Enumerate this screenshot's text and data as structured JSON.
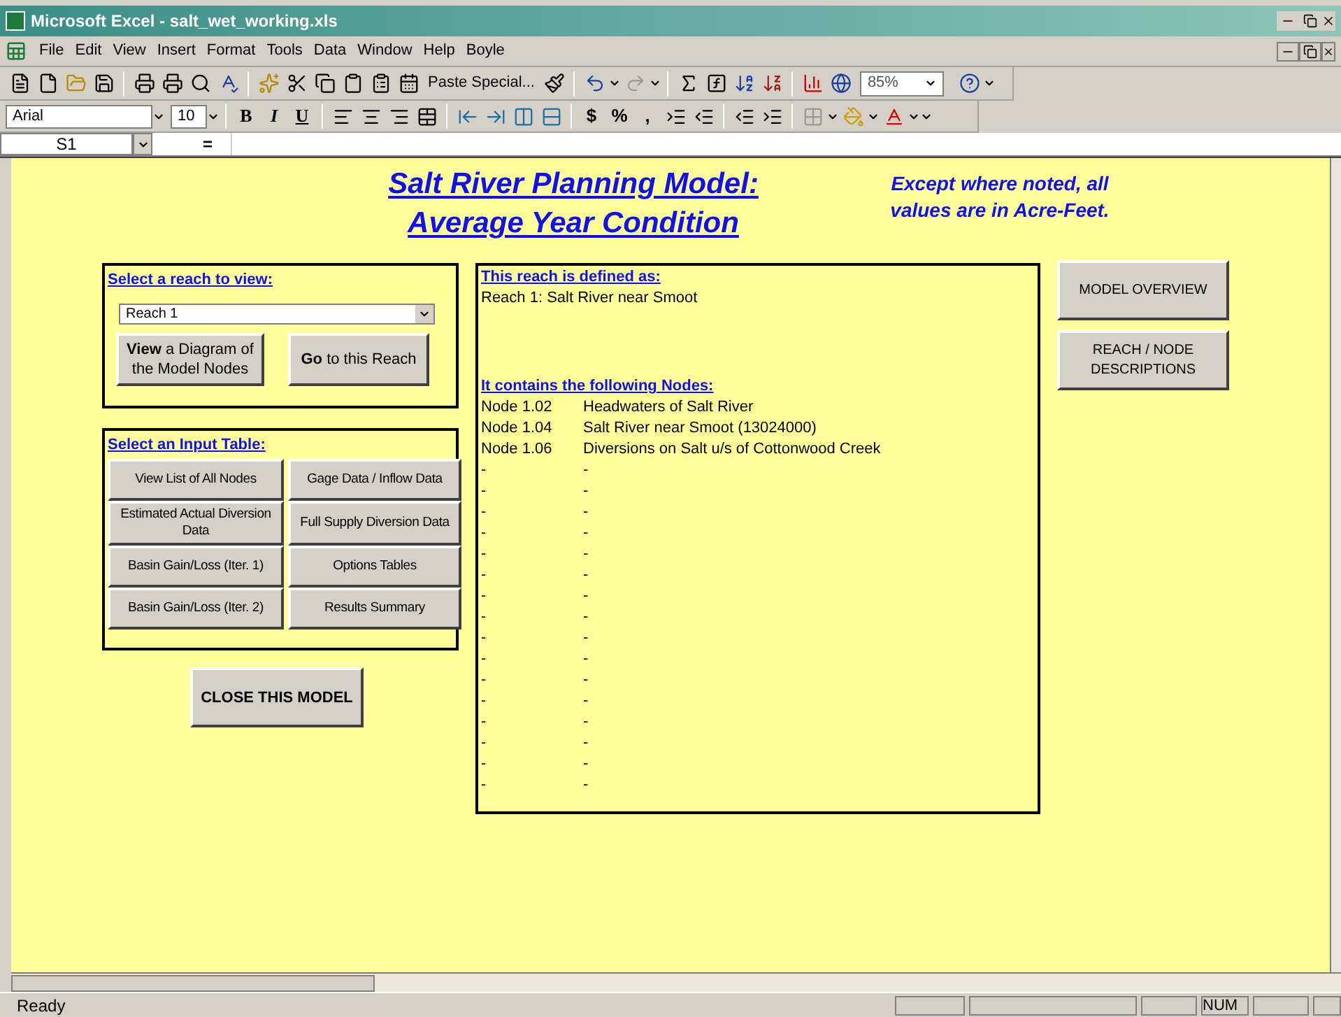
{
  "window": {
    "title": "Microsoft Excel - salt_wet_working.xls"
  },
  "menu": [
    "File",
    "Edit",
    "View",
    "Insert",
    "Format",
    "Tools",
    "Data",
    "Window",
    "Help",
    "Boyle"
  ],
  "toolbar": {
    "paste_special": "Paste Special...",
    "zoom": "85%"
  },
  "format_toolbar": {
    "font": "Arial",
    "size": "10",
    "style_buttons": [
      "B",
      "I",
      "U"
    ],
    "number_buttons": [
      "$",
      "%",
      ","
    ]
  },
  "formula_bar": {
    "name_box": "S1",
    "equals": "="
  },
  "sheet": {
    "title_lines": [
      "Salt River Planning Model:",
      "Average Year Condition"
    ],
    "note": "Except where noted, all values are in Acre-Feet.",
    "reach_panel": {
      "heading": "Select a reach to view:",
      "dropdown": "Reach 1",
      "buttons": [
        {
          "bold": "View",
          "rest": "a Diagram of the Model Nodes"
        },
        {
          "bold": "Go",
          "rest": "to this Reach"
        }
      ]
    },
    "input_panel": {
      "heading": "Select an Input Table:",
      "buttons": [
        "View List of All Nodes",
        "Gage Data / Inflow Data",
        "Estimated Actual Diversion Data",
        "Full Supply Diversion Data",
        "Basin Gain/Loss (Iter. 1)",
        "Options Tables",
        "Basin Gain/Loss (Iter. 2)",
        "Results Summary"
      ]
    },
    "close_button": "CLOSE THIS MODEL",
    "info_panel": {
      "definition_heading": "This reach is defined as:",
      "definition": "Reach 1: Salt River near Smoot",
      "nodes_heading": "It contains the following Nodes:",
      "nodes": [
        {
          "id": "Node 1.02",
          "name": "Headwaters of Salt River"
        },
        {
          "id": "Node 1.04",
          "name": "Salt River near Smoot (13024000)"
        },
        {
          "id": "Node 1.06",
          "name": "Diversions on Salt u/s of Cottonwood Creek"
        },
        {
          "id": "-",
          "name": "-"
        },
        {
          "id": "-",
          "name": "-"
        },
        {
          "id": "-",
          "name": "-"
        },
        {
          "id": "-",
          "name": "-"
        },
        {
          "id": "-",
          "name": "-"
        },
        {
          "id": "-",
          "name": "-"
        },
        {
          "id": "-",
          "name": "-"
        },
        {
          "id": "-",
          "name": "-"
        },
        {
          "id": "-",
          "name": "-"
        },
        {
          "id": "-",
          "name": "-"
        },
        {
          "id": "-",
          "name": "-"
        },
        {
          "id": "-",
          "name": "-"
        },
        {
          "id": "-",
          "name": "-"
        },
        {
          "id": "-",
          "name": "-"
        },
        {
          "id": "-",
          "name": "-"
        },
        {
          "id": "-",
          "name": "-"
        }
      ]
    },
    "side_buttons": [
      "MODEL OVERVIEW",
      "REACH / NODE DESCRIPTIONS"
    ]
  },
  "status_bar": {
    "status": "Ready",
    "indicator": "NUM"
  }
}
